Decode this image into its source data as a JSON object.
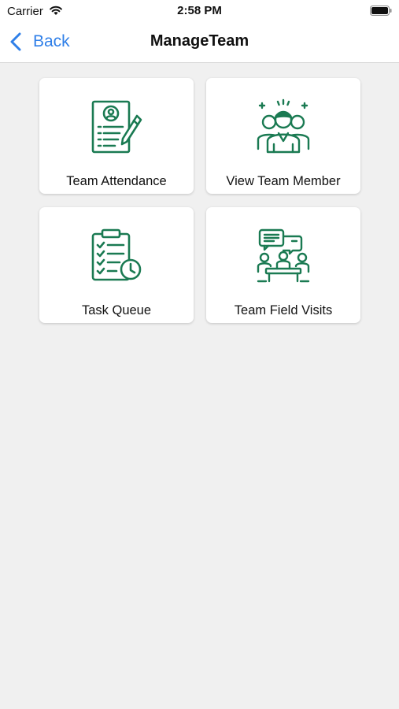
{
  "status_bar": {
    "carrier": "Carrier",
    "time": "2:58 PM"
  },
  "nav": {
    "back_label": "Back",
    "title": "ManageTeam"
  },
  "colors": {
    "accent": "#2f7fe8",
    "icon": "#1a7a52",
    "background": "#f0f0f0"
  },
  "cards": [
    {
      "label": "Team Attendance",
      "icon": "attendance-form-icon"
    },
    {
      "label": "View Team Member",
      "icon": "team-members-icon"
    },
    {
      "label": "Task Queue",
      "icon": "task-clipboard-icon"
    },
    {
      "label": "Team Field Visits",
      "icon": "meeting-chat-icon"
    }
  ]
}
